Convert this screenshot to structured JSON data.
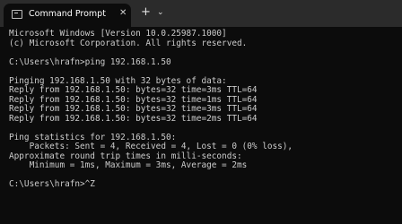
{
  "window": {
    "tab_title": "Command Prompt",
    "tab_icon": "terminal-icon",
    "close_label": "✕",
    "new_tab_label": "+",
    "dropdown_label": "⌄"
  },
  "terminal": {
    "lines": [
      "Microsoft Windows [Version 10.0.25987.1000]",
      "(c) Microsoft Corporation. All rights reserved.",
      "",
      "C:\\Users\\hrafn>ping 192.168.1.50",
      "",
      "Pinging 192.168.1.50 with 32 bytes of data:",
      "Reply from 192.168.1.50: bytes=32 time=3ms TTL=64",
      "Reply from 192.168.1.50: bytes=32 time=1ms TTL=64",
      "Reply from 192.168.1.50: bytes=32 time=3ms TTL=64",
      "Reply from 192.168.1.50: bytes=32 time=2ms TTL=64",
      "",
      "Ping statistics for 192.168.1.50:",
      "    Packets: Sent = 4, Received = 4, Lost = 0 (0% loss),",
      "Approximate round trip times in milli-seconds:",
      "    Minimum = 1ms, Maximum = 3ms, Average = 2ms",
      "",
      "C:\\Users\\hrafn>^Z"
    ]
  },
  "colors": {
    "background": "#0c0c0c",
    "titlebar": "#2b2b2b",
    "text": "#cccccc"
  }
}
